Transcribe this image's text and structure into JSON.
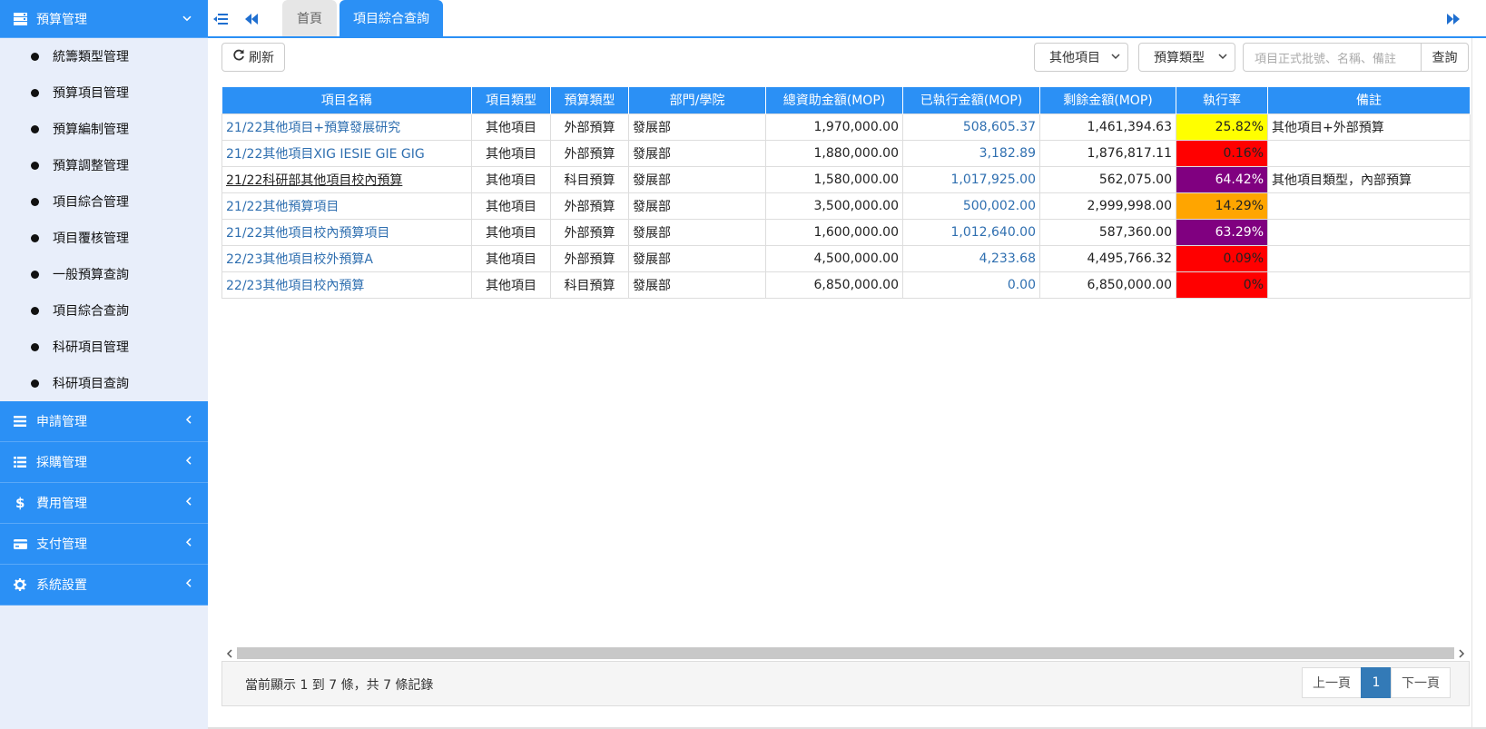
{
  "sidebar": {
    "budget": {
      "label": "預算管理",
      "items": [
        {
          "label": "統籌類型管理"
        },
        {
          "label": "預算項目管理"
        },
        {
          "label": "預算編制管理"
        },
        {
          "label": "預算調整管理"
        },
        {
          "label": "項目綜合管理"
        },
        {
          "label": "項目覆核管理"
        },
        {
          "label": "一般預算查詢"
        },
        {
          "label": "項目綜合查詢"
        },
        {
          "label": "科研項目管理"
        },
        {
          "label": "科研項目查詢"
        }
      ]
    },
    "menus": [
      {
        "label": "申請管理",
        "icon": "menu-lines-icon"
      },
      {
        "label": "採購管理",
        "icon": "list-icon"
      },
      {
        "label": "費用管理",
        "icon": "dollar-icon"
      },
      {
        "label": "支付管理",
        "icon": "credit-card-icon"
      },
      {
        "label": "系統設置",
        "icon": "gear-icon"
      }
    ]
  },
  "tabs": {
    "home": "首頁",
    "active": "項目綜合查詢"
  },
  "toolbar": {
    "refresh_label": "刷新",
    "filter1": "其他項目",
    "filter2": "預算類型",
    "search_placeholder": "項目正式批號、名稱、備註",
    "search_label": "查詢"
  },
  "table": {
    "headers": [
      "項目名稱",
      "項目類型",
      "預算類型",
      "部門/學院",
      "總資助金額(MOP)",
      "已執行金額(MOP)",
      "剩餘金額(MOP)",
      "執行率",
      "備註"
    ],
    "rows": [
      {
        "name": "21/22其他項目+預算發展研究",
        "type": "其他項目",
        "budget": "外部預算",
        "dept": "發展部",
        "total": "1,970,000.00",
        "executed": "508,605.37",
        "remaining": "1,461,394.63",
        "rate": "25.82%",
        "rate_color": "#ffff00",
        "rate_text_color": "#222222",
        "note": "其他項目+外部預算"
      },
      {
        "name": "21/22其他項目XIG IESIE GIE GIG",
        "type": "其他項目",
        "budget": "外部預算",
        "dept": "發展部",
        "total": "1,880,000.00",
        "executed": "3,182.89",
        "remaining": "1,876,817.11",
        "rate": "0.16%",
        "rate_color": "#ff0000",
        "rate_text_color": "#222222",
        "note": ""
      },
      {
        "name": "21/22科研部其他項目校內預算",
        "type": "其他項目",
        "budget": "科目預算",
        "dept": "發展部",
        "total": "1,580,000.00",
        "executed": "1,017,925.00",
        "remaining": "562,075.00",
        "rate": "64.42%",
        "rate_color": "#800080",
        "rate_text_color": "#ffffff",
        "note": "其他項目類型，內部預算"
      },
      {
        "name": "21/22其他預算項目",
        "type": "其他項目",
        "budget": "外部預算",
        "dept": "發展部",
        "total": "3,500,000.00",
        "executed": "500,002.00",
        "remaining": "2,999,998.00",
        "rate": "14.29%",
        "rate_color": "#ffa500",
        "rate_text_color": "#222222",
        "note": ""
      },
      {
        "name": "21/22其他項目校內預算項目",
        "type": "其他項目",
        "budget": "外部預算",
        "dept": "發展部",
        "total": "1,600,000.00",
        "executed": "1,012,640.00",
        "remaining": "587,360.00",
        "rate": "63.29%",
        "rate_color": "#800080",
        "rate_text_color": "#ffffff",
        "note": ""
      },
      {
        "name": "22/23其他項目校外預算A",
        "type": "其他項目",
        "budget": "外部預算",
        "dept": "發展部",
        "total": "4,500,000.00",
        "executed": "4,233.68",
        "remaining": "4,495,766.32",
        "rate": "0.09%",
        "rate_color": "#ff0000",
        "rate_text_color": "#222222",
        "note": ""
      },
      {
        "name": "22/23其他項目校內預算",
        "type": "其他項目",
        "budget": "科目預算",
        "dept": "發展部",
        "total": "6,850,000.00",
        "executed": "0.00",
        "remaining": "6,850,000.00",
        "rate": "0%",
        "rate_color": "#ff0000",
        "rate_text_color": "#222222",
        "note": ""
      }
    ]
  },
  "footer": {
    "summary": "當前顯示 1 到 7 條，共 7 條記錄",
    "prev": "上一頁",
    "page": "1",
    "next": "下一頁"
  },
  "colors": {
    "accent": "#2b90f5",
    "sidebar_bg": "#e8eefa",
    "link": "#2f6fb0"
  }
}
